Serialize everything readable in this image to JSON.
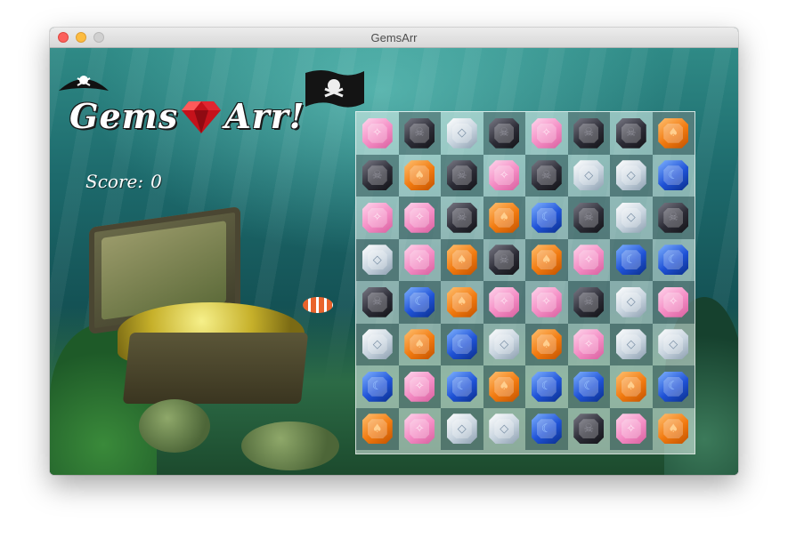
{
  "window": {
    "title": "GemsArr"
  },
  "logo": {
    "word1": "Gems",
    "word2": "Arr!"
  },
  "score": {
    "label": "Score:",
    "value": "0"
  },
  "board": {
    "rows": 8,
    "cols": 8,
    "grid": [
      [
        "pink",
        "black",
        "silver",
        "black",
        "pink",
        "black",
        "black",
        "orange"
      ],
      [
        "black",
        "orange",
        "black",
        "pink",
        "black",
        "silver",
        "silver",
        "blue"
      ],
      [
        "pink",
        "pink",
        "black",
        "orange",
        "blue",
        "black",
        "silver",
        "black"
      ],
      [
        "silver",
        "pink",
        "orange",
        "black",
        "orange",
        "pink",
        "blue",
        "blue"
      ],
      [
        "black",
        "blue",
        "orange",
        "pink",
        "pink",
        "black",
        "silver",
        "pink"
      ],
      [
        "silver",
        "orange",
        "blue",
        "silver",
        "orange",
        "pink",
        "silver",
        "silver"
      ],
      [
        "blue",
        "pink",
        "blue",
        "orange",
        "blue",
        "blue",
        "orange",
        "blue"
      ],
      [
        "orange",
        "pink",
        "silver",
        "silver",
        "blue",
        "black",
        "pink",
        "orange"
      ]
    ]
  },
  "gem_types": {
    "pink": {
      "color": "#f48cc4",
      "icon": "sparkle-icon"
    },
    "black": {
      "color": "#2c2c36",
      "icon": "skull-icon"
    },
    "silver": {
      "color": "#c8d4df",
      "icon": "diamond-icon"
    },
    "orange": {
      "color": "#f17a10",
      "icon": "spade-icon"
    },
    "blue": {
      "color": "#1f52d6",
      "icon": "moon-icon"
    }
  }
}
